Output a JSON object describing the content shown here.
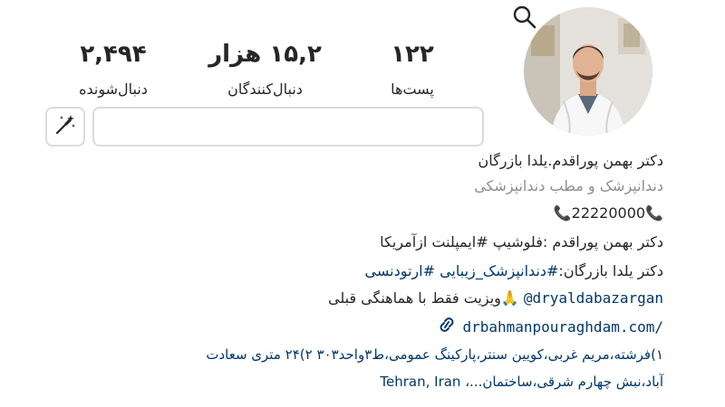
{
  "profile": {
    "stats": {
      "posts": {
        "value": "۱۲۲",
        "label": "پست‌ها"
      },
      "followers": {
        "value": "۱۵,۲ هزار",
        "label": "دنبال‌کنندگان"
      },
      "following": {
        "value": "۲,۴۹۴",
        "label": "دنبال‌شونده"
      }
    },
    "name": "دکتر بهمن پوراقدم.یلدا بازرگان",
    "category": "دندانپزشک و مطب دندانپزشکی",
    "bio": {
      "phone": "📞22220000📞",
      "line1": "دکتر بهمن پوراقدم :فلوشیپ  #ایمپلنت  ازآمریکا",
      "line2_prefix": "دکتر یلدا بازرگان:",
      "line2_tags": "#دندانپزشک_زیبایی #ارتودنسی",
      "line3_mention": "@dryaldabazargan",
      "line3_text": " 🙏ویزیت فقط با هماهنگی قبلی",
      "website": "drbahmanpouraghdam.com/",
      "address_line1": "۱)فرشته،مریم غربی،کویین سنتر،پارکینگ عمومی،ط۳واحد۳۰۳   ۲)۲۴ متری سعادت",
      "address_line2": "آباد،نبش چهارم شرقی،ساختمان...، Tehran, Iran"
    }
  },
  "icons": {
    "search": "search-icon",
    "magic": "magic-wand-icon",
    "link": "link-icon"
  },
  "colors": {
    "text": "#262626",
    "muted": "#8e8e8e",
    "link": "#00376b",
    "border": "#dbdbdb"
  }
}
